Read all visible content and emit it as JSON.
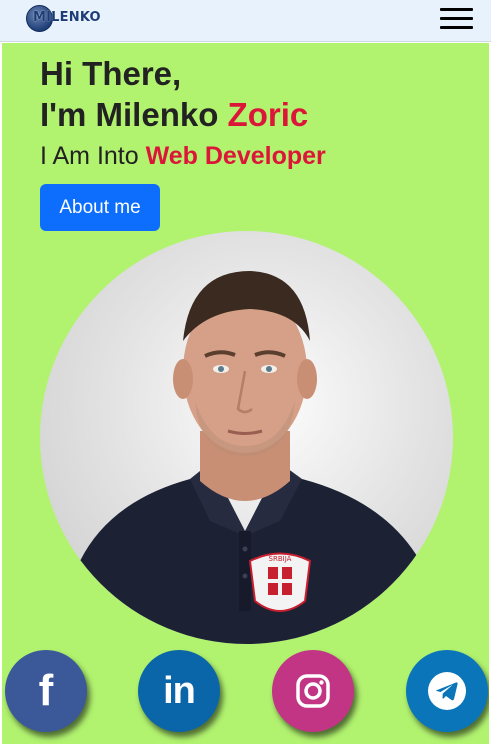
{
  "navbar": {
    "logo_text": "MILENKO",
    "menu_icon": "hamburger-menu-icon"
  },
  "hero": {
    "greeting_line1": "Hi There,",
    "greeting_line2_prefix": "I'm Milenko ",
    "greeting_line2_accent": "Zoric",
    "tagline_prefix": "I Am Into ",
    "tagline_accent": "Web Developer",
    "about_button": "About me",
    "portrait": "profile-photo",
    "shirt_badge_text": "SRBIJA"
  },
  "social": [
    {
      "name": "facebook-icon",
      "glyph": "f"
    },
    {
      "name": "linkedin-icon",
      "glyph": "in"
    },
    {
      "name": "instagram-icon"
    },
    {
      "name": "telegram-icon"
    }
  ],
  "colors": {
    "hero_bg": "#b1f26f",
    "accent": "#dc1638",
    "button": "#0d6efd",
    "navbar_bg": "#e8f2fc",
    "facebook": "#3b5998",
    "linkedin": "#0a66a8",
    "instagram": "#c13584",
    "telegram": "#0a76b9"
  }
}
